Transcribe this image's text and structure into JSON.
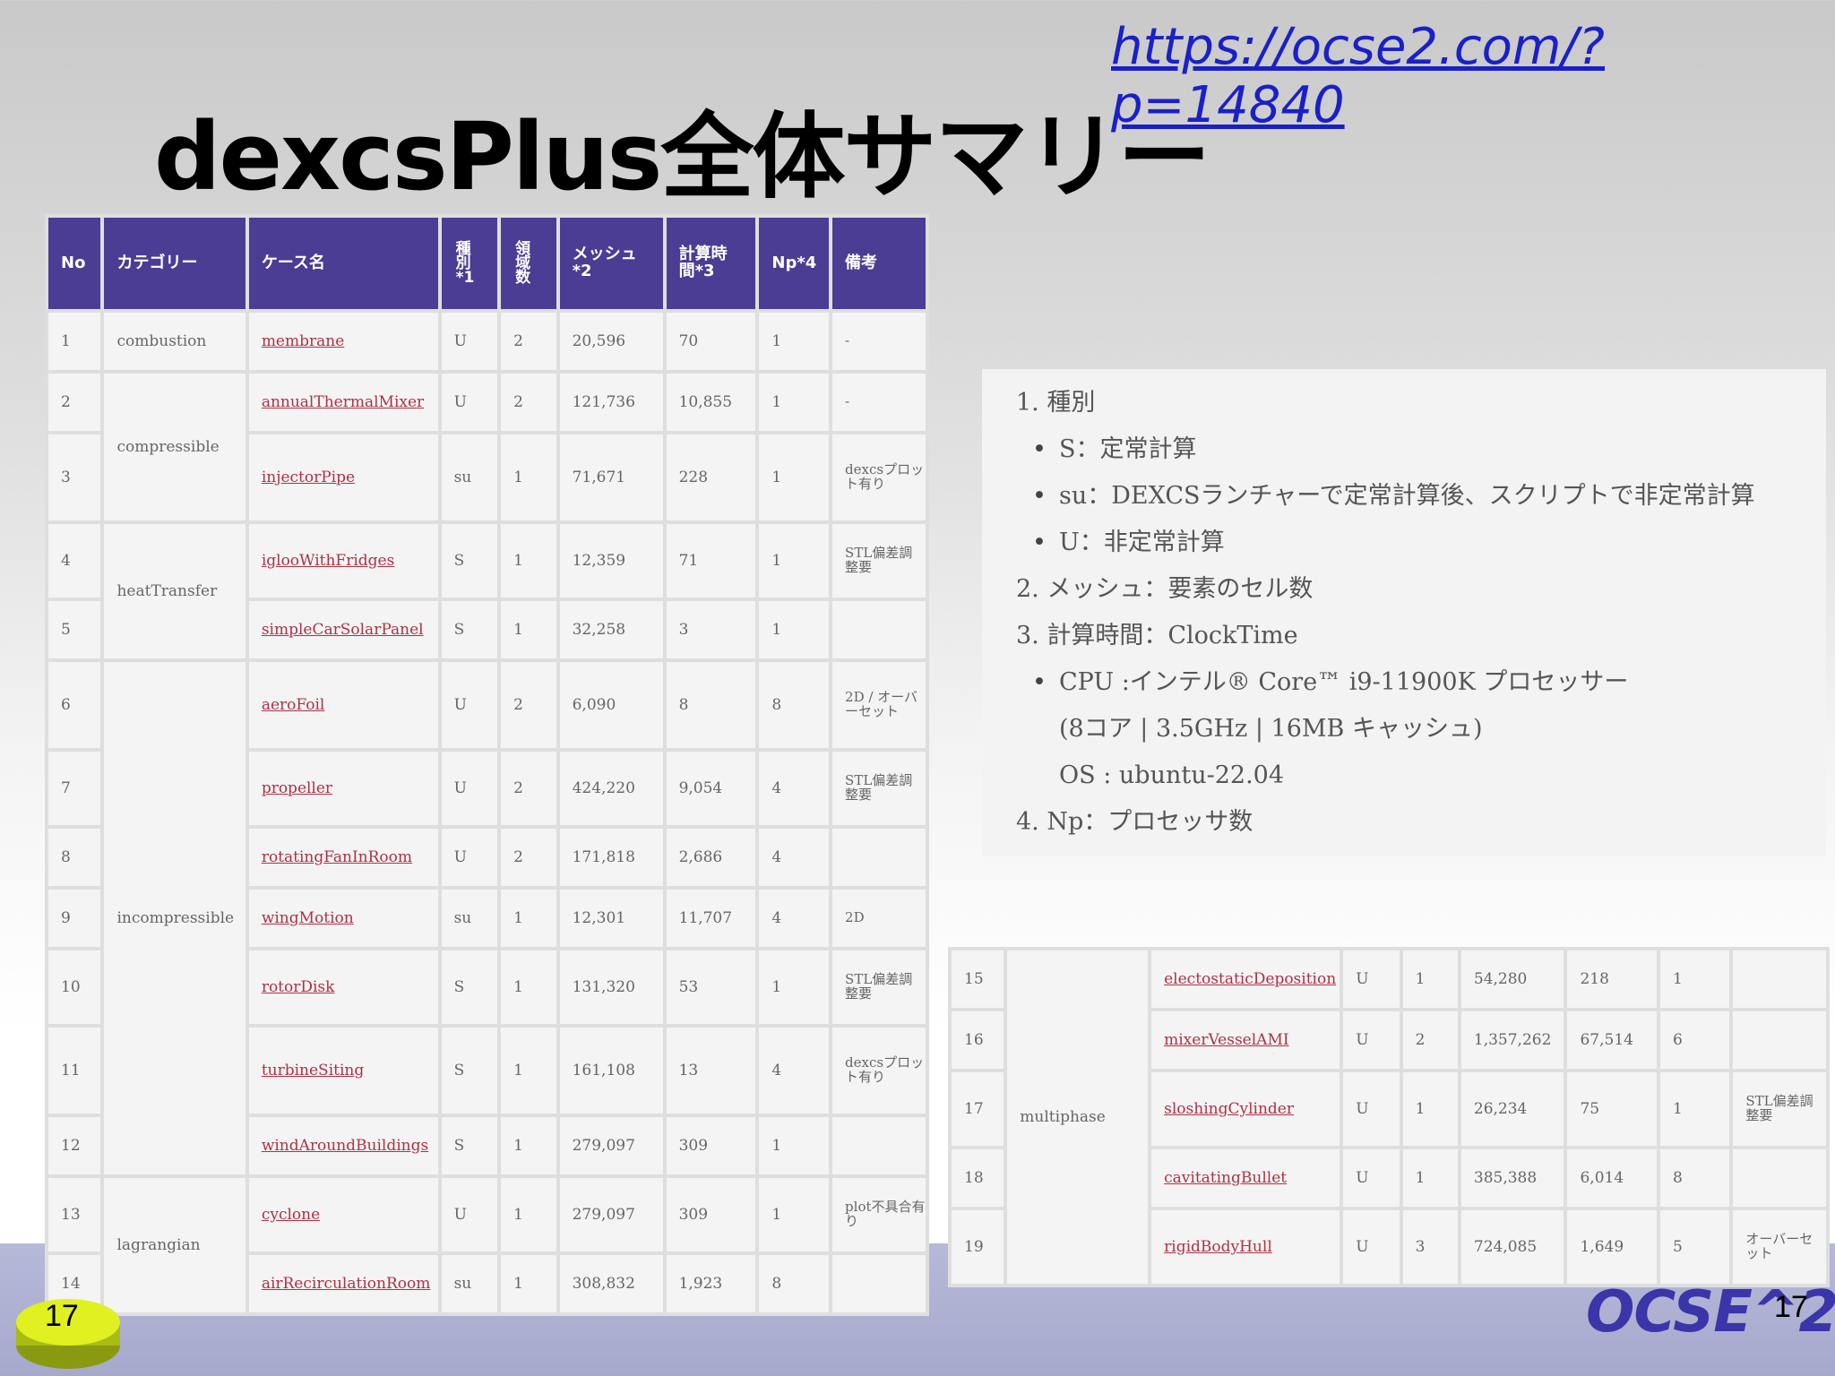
{
  "url": "https://ocse2.com/?p=14840",
  "title": "dexcsPlus全体サマリー",
  "headers": {
    "no": "No",
    "category": "カテゴリー",
    "case_name": "ケース名",
    "kind": [
      "種",
      "別",
      "*1"
    ],
    "regions": [
      "領",
      "域",
      "数"
    ],
    "mesh": [
      "メッシュ",
      "*2"
    ],
    "calc_time": [
      "計算時",
      "間*3"
    ],
    "np": "Np*4",
    "remarks": "備考"
  },
  "left_rows": [
    {
      "no": "1",
      "category": "combustion",
      "case": "membrane",
      "kind": "U",
      "regions": "2",
      "mesh": "20,596",
      "time": "70",
      "np": "1",
      "note": "-"
    },
    {
      "no": "2",
      "category": "compressible",
      "case": "annualThermalMixer",
      "kind": "U",
      "regions": "2",
      "mesh": "121,736",
      "time": "10,855",
      "np": "1",
      "note": "-"
    },
    {
      "no": "3",
      "category": "",
      "case": "injectorPipe",
      "kind": "su",
      "regions": "1",
      "mesh": "71,671",
      "time": "228",
      "np": "1",
      "note": "dexcsプロット有り"
    },
    {
      "no": "4",
      "category": "heatTransfer",
      "case": "iglooWithFridges",
      "kind": "S",
      "regions": "1",
      "mesh": "12,359",
      "time": "71",
      "np": "1",
      "note": "STL偏差調整要"
    },
    {
      "no": "5",
      "category": "",
      "case": "simpleCarSolarPanel",
      "kind": "S",
      "regions": "1",
      "mesh": "32,258",
      "time": "3",
      "np": "1",
      "note": ""
    },
    {
      "no": "6",
      "category": "incompressible",
      "case": "aeroFoil",
      "kind": "U",
      "regions": "2",
      "mesh": "6,090",
      "time": "8",
      "np": "8",
      "note": "2D / オーバーセット"
    },
    {
      "no": "7",
      "category": "",
      "case": "propeller",
      "kind": "U",
      "regions": "2",
      "mesh": "424,220",
      "time": "9,054",
      "np": "4",
      "note": "STL偏差調整要"
    },
    {
      "no": "8",
      "category": "",
      "case": "rotatingFanInRoom",
      "kind": "U",
      "regions": "2",
      "mesh": "171,818",
      "time": "2,686",
      "np": "4",
      "note": ""
    },
    {
      "no": "9",
      "category": "",
      "case": "wingMotion",
      "kind": "su",
      "regions": "1",
      "mesh": "12,301",
      "time": "11,707",
      "np": "4",
      "note": "2D"
    },
    {
      "no": "10",
      "category": "",
      "case": "rotorDisk",
      "kind": "S",
      "regions": "1",
      "mesh": "131,320",
      "time": "53",
      "np": "1",
      "note": "STL偏差調整要"
    },
    {
      "no": "11",
      "category": "",
      "case": "turbineSiting",
      "kind": "S",
      "regions": "1",
      "mesh": "161,108",
      "time": "13",
      "np": "4",
      "note": "dexcsプロット有り"
    },
    {
      "no": "12",
      "category": "",
      "case": "windAroundBuildings",
      "kind": "S",
      "regions": "1",
      "mesh": "279,097",
      "time": "309",
      "np": "1",
      "note": ""
    },
    {
      "no": "13",
      "category": "lagrangian",
      "case": "cyclone",
      "kind": "U",
      "regions": "1",
      "mesh": "279,097",
      "time": "309",
      "np": "1",
      "note": "plot不具合有り"
    },
    {
      "no": "14",
      "category": "",
      "case": "airRecirculationRoom",
      "kind": "su",
      "regions": "1",
      "mesh": "308,832",
      "time": "1,923",
      "np": "8",
      "note": ""
    }
  ],
  "right_rows": [
    {
      "no": "15",
      "category": "multiphase",
      "case": "electostaticDeposition",
      "kind": "U",
      "regions": "1",
      "mesh": "54,280",
      "time": "218",
      "np": "1",
      "note": ""
    },
    {
      "no": "16",
      "category": "",
      "case": "mixerVesselAMI",
      "kind": "U",
      "regions": "2",
      "mesh": "1,357,262",
      "time": "67,514",
      "np": "6",
      "note": ""
    },
    {
      "no": "17",
      "category": "",
      "case": "sloshingCylinder",
      "kind": "U",
      "regions": "1",
      "mesh": "26,234",
      "time": "75",
      "np": "1",
      "note": "STL偏差調整要"
    },
    {
      "no": "18",
      "category": "",
      "case": "cavitatingBullet",
      "kind": "U",
      "regions": "1",
      "mesh": "385,388",
      "time": "6,014",
      "np": "8",
      "note": ""
    },
    {
      "no": "19",
      "category": "",
      "case": "rigidBodyHull",
      "kind": "U",
      "regions": "3",
      "mesh": "724,085",
      "time": "1,649",
      "np": "5",
      "note": "オーバーセット"
    }
  ],
  "notes": {
    "n1": "1. 種別",
    "n1_s": "S：定常計算",
    "n1_su": "su：DEXCSランチャーで定常計算後、スクリプトで非定常計算",
    "n1_u": "U：非定常計算",
    "n2": "2. メッシュ：要素のセル数",
    "n3": "3. 計算時間：ClockTime",
    "n3_cpu": "CPU :インテル® Core™ i9-11900K プロセッサー",
    "n3_cpu2": "(8コア  | 3.5GHz | 16MB キャッシュ)",
    "n3_os": "OS : ubuntu-22.04",
    "n4": "4. Np：プロセッサ数"
  },
  "page_number": "17",
  "logo": "OCSE^2",
  "colors": {
    "header_bg": "#4a3d93",
    "link": "#b03044",
    "url": "#1a20c8"
  }
}
